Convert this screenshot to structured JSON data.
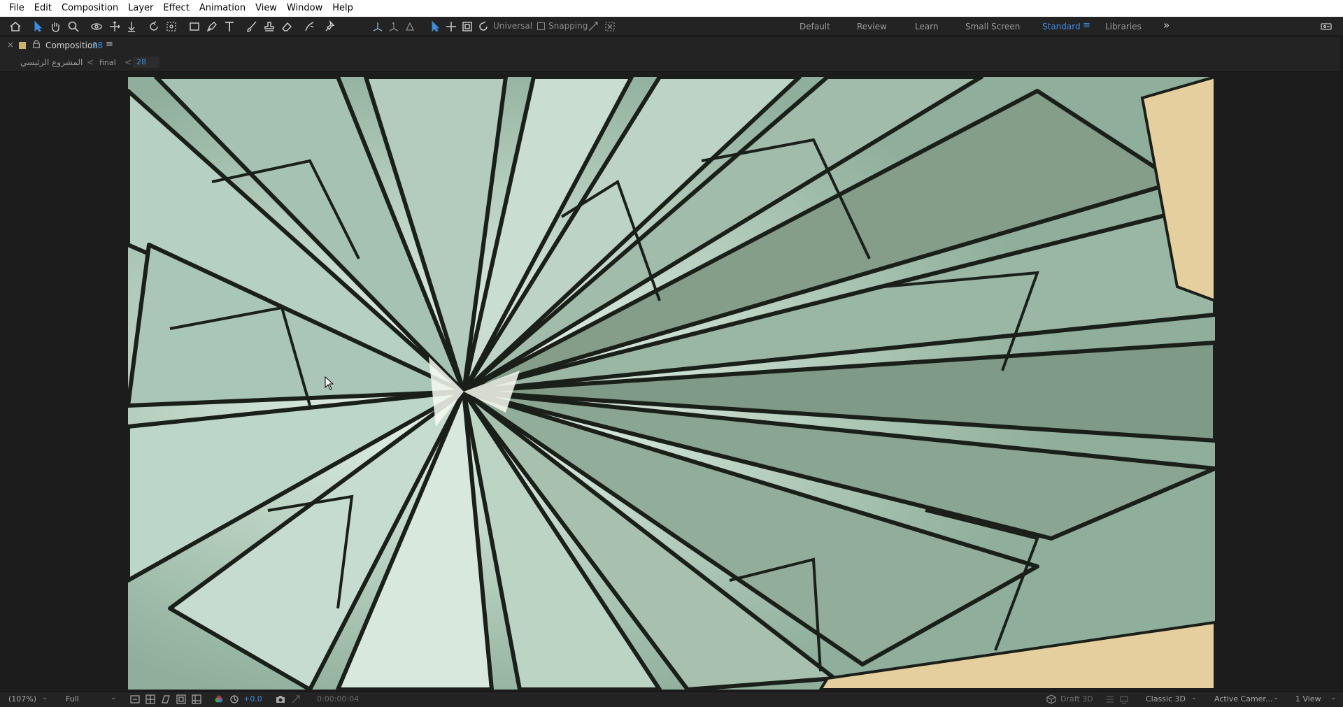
{
  "menu": [
    "File",
    "Edit",
    "Composition",
    "Layer",
    "Effect",
    "Animation",
    "View",
    "Window",
    "Help"
  ],
  "toolbar": {
    "axis_mode": "Universal",
    "snapping_label": "Snapping"
  },
  "workspaces": {
    "items": [
      "Default",
      "Review",
      "Learn",
      "Small Screen",
      "Standard",
      "Libraries"
    ],
    "active": "Standard",
    "overflow": "»"
  },
  "panel": {
    "title": "Composition",
    "comp_number": "28",
    "menu_glyph": "≡",
    "close_glyph": "×"
  },
  "breadcrumb": {
    "items": [
      "المشروع الرئيسي",
      "final",
      "28"
    ],
    "separator": "<"
  },
  "footer": {
    "zoom": "(107%)",
    "resolution": "Full",
    "exposure": "+0.0",
    "timecode": "0:00:00:04",
    "renderer_draft": "Draft 3D",
    "renderer": "Classic 3D",
    "camera": "Active Camer...",
    "views": "1 View"
  },
  "colors": {
    "accent": "#3c8dde",
    "panel_bg": "#232323",
    "menubar_bg": "#ffffff",
    "label_swatch": "#c8b36c"
  }
}
